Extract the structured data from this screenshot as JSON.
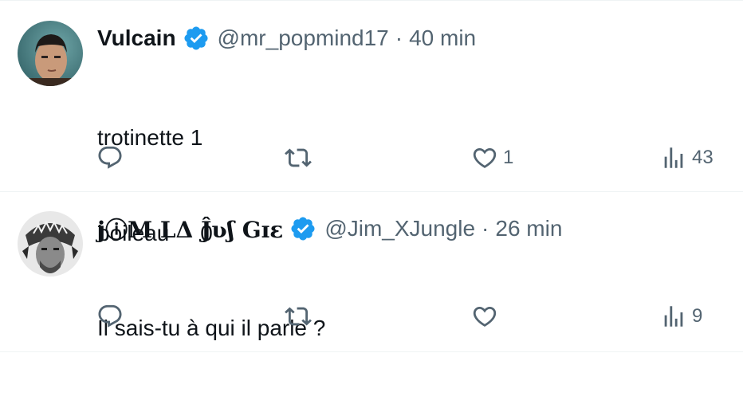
{
  "tweets": [
    {
      "name": "Vulcain",
      "handle": "@mr_popmind17",
      "separator": "·",
      "time": "40 min",
      "lines": [
        "trotinette 1",
        "boileau     0"
      ],
      "likes": "1",
      "views": "43"
    },
    {
      "name": "jⓘM LΔ Ĵʋʃ Gɪɛ",
      "handle": "@Jim_XJungle",
      "separator": "·",
      "time": "26 min",
      "lines": [
        "Il sais-tu à qui il parle ?"
      ],
      "likes": "",
      "views": "9"
    }
  ],
  "colors": {
    "verified": "#1d9bf0",
    "muted": "#536471",
    "text": "#0f1419",
    "divider": "#eff3f4"
  },
  "icons": [
    "reply-icon",
    "retweet-icon",
    "like-icon",
    "views-icon",
    "verified-badge-icon"
  ]
}
